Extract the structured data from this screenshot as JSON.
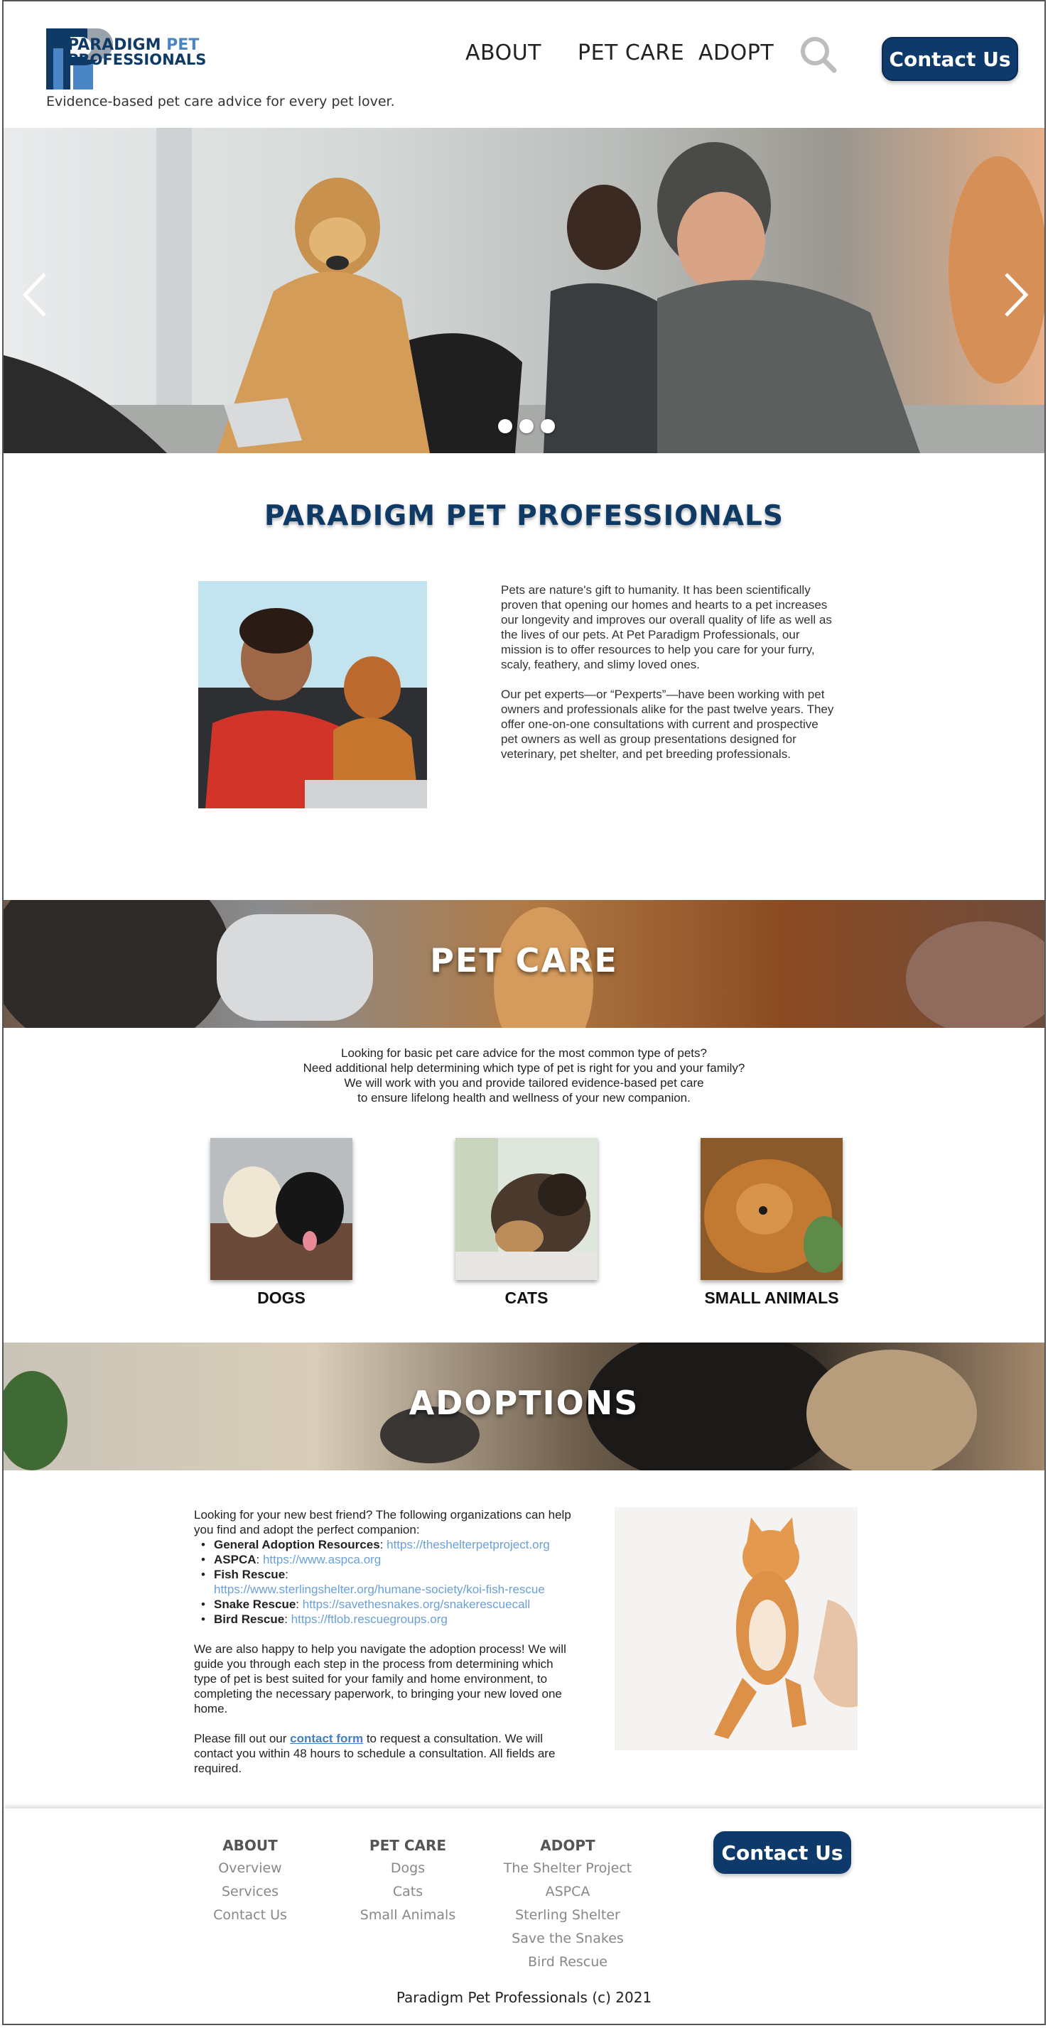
{
  "header": {
    "logo_line1": "PARADIGM",
    "logo_line1_accent": "PET",
    "logo_line2": "PROFESSIONALS",
    "tagline": "Evidence-based pet care advice for every pet lover.",
    "nav": [
      "ABOUT",
      "PET CARE",
      "ADOPT"
    ],
    "search_icon": "search-icon",
    "contact_label": "Contact Us"
  },
  "hero": {
    "prev_icon": "chevron-left-icon",
    "next_icon": "chevron-right-icon",
    "slide_count": 3
  },
  "about": {
    "title": "PARADIGM PET PROFESSIONALS",
    "paragraph1": "Pets are nature's gift to humanity. It has been scientifically proven that opening our homes and hearts to a pet increases our longevity and improves our overall quality of life as well as the lives of our pets. At Pet Paradigm Professionals, our mission is to offer resources to help you care for your furry, scaly, feathery, and slimy loved ones.",
    "paragraph2": "Our pet experts—or “Pexperts”—have been working with pet owners and professionals alike for the past twelve years. They offer one-on-one consultations with current and prospective pet owners as well as group presentations designed for veterinary, pet shelter, and pet breeding professionals."
  },
  "pet_care": {
    "title": "PET CARE",
    "intro1": "Looking for basic pet care advice for the most common type of pets?",
    "intro2": "Need additional help determining which type of pet is right for you and your family?",
    "intro3": "We will work with you and provide tailored evidence-based pet care",
    "intro4": "to ensure lifelong health and wellness of your new companion.",
    "cards": [
      "DOGS",
      "CATS",
      "SMALL ANIMALS"
    ]
  },
  "adoptions": {
    "title": "ADOPTIONS",
    "intro": "Looking for your new best friend? The following organizations can help you find and adopt the perfect companion:",
    "orgs": [
      {
        "name": "General Adoption Resources",
        "url": "https://theshelterpetproject.org"
      },
      {
        "name": "ASPCA",
        "url": "https://www.aspca.org"
      },
      {
        "name": "Fish Rescue",
        "url": "https://www.sterlingshelter.org/humane-society/koi-fish-rescue"
      },
      {
        "name": "Snake Rescue",
        "url": "https://savethesnakes.org/snakerescuecall"
      },
      {
        "name": "Bird Rescue",
        "url": "https://ftlob.rescuegroups.org"
      }
    ],
    "process": "We are also happy to help you navigate the adoption process! We will guide you through each step in the process from determining which type of pet is best suited for your family and home environment, to completing the necessary paperwork, to bringing your new loved one home.",
    "form_prefix": "Please fill out our ",
    "form_link": "contact form",
    "form_suffix": " to request a consultation. We will contact you within 48 hours to schedule a consultation. All fields are required."
  },
  "footer": {
    "about": {
      "heading": "ABOUT",
      "links": [
        "Overview",
        "Services",
        "Contact Us"
      ]
    },
    "pet_care": {
      "heading": "PET CARE",
      "links": [
        "Dogs",
        "Cats",
        "Small Animals"
      ]
    },
    "adopt": {
      "heading": "ADOPT",
      "links": [
        "The Shelter Project",
        "ASPCA",
        "Sterling Shelter",
        "Save the Snakes",
        "Bird Rescue"
      ]
    },
    "contact_label": "Contact Us",
    "copyright": "Paradigm Pet Professionals (c) 2021"
  },
  "colors": {
    "brand_navy": "#0d3a6b",
    "brand_blue": "#4a86c5",
    "link_blue": "#6aa0d8"
  }
}
